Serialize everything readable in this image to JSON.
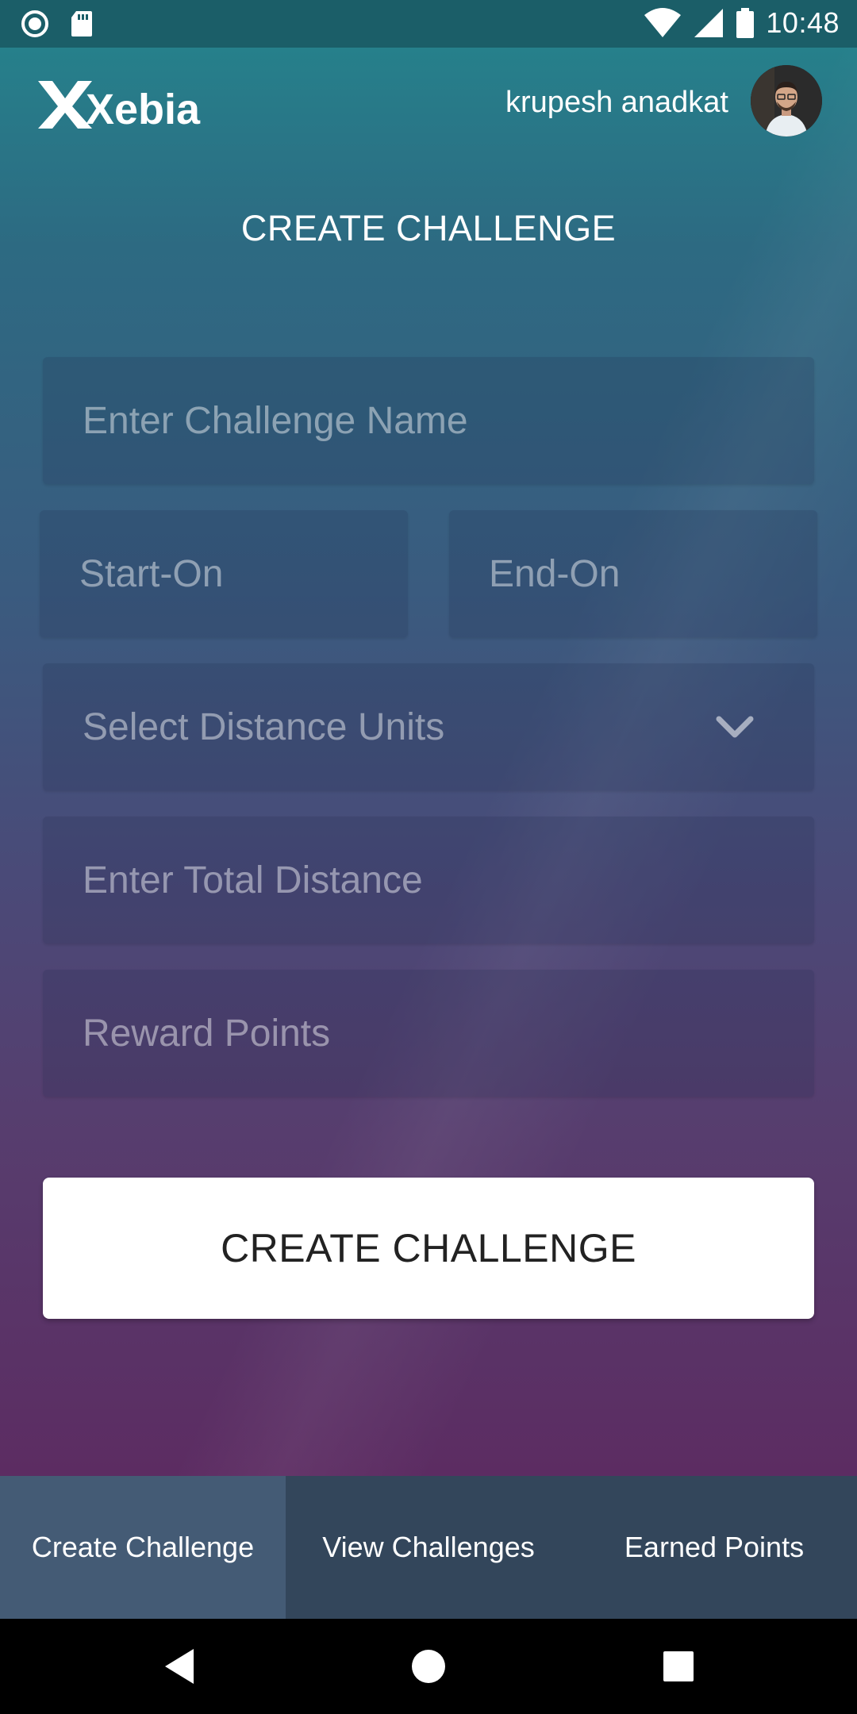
{
  "status_bar": {
    "time": "10:48",
    "icons": [
      "record-icon",
      "sd-card-icon",
      "wifi-icon",
      "signal-icon",
      "battery-icon"
    ]
  },
  "header": {
    "logo_text": "Xebia",
    "user_name": "krupesh anadkat"
  },
  "page_title": "CREATE CHALLENGE",
  "form": {
    "challenge_name_placeholder": "Enter Challenge Name",
    "start_on_placeholder": "Start-On",
    "end_on_placeholder": "End-On",
    "distance_units_placeholder": "Select Distance Units",
    "total_distance_placeholder": "Enter Total Distance",
    "reward_points_placeholder": "Reward Points",
    "submit_label": "CREATE CHALLENGE"
  },
  "tabs": [
    {
      "label": "Create Challenge",
      "active": true
    },
    {
      "label": "View Challenges",
      "active": false
    },
    {
      "label": "Earned Points",
      "active": false
    }
  ],
  "colors": {
    "status_bar": "#1b5e68",
    "gradient_top": "#26808b",
    "gradient_bottom": "#5c2c62",
    "tab_bar": "#33465b",
    "tab_active": "#445b75",
    "button_bg": "#ffffff"
  }
}
